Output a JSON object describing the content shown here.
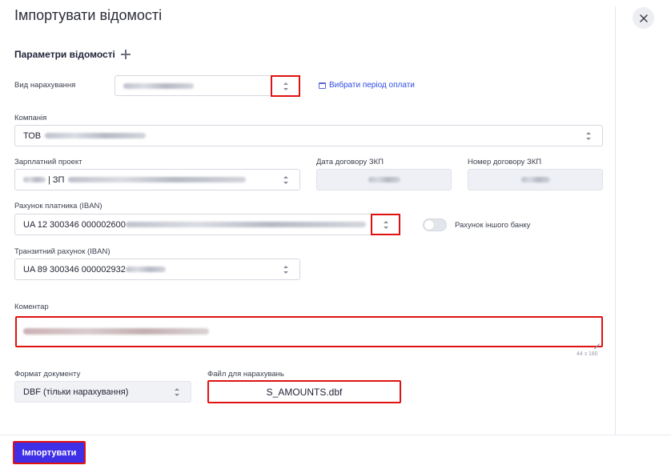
{
  "dialog": {
    "title": "Імпортувати відомості",
    "close_icon": "close-icon"
  },
  "section": {
    "title": "Параметри відомості"
  },
  "accrual_type": {
    "label": "Вид нарахування",
    "value": ""
  },
  "period_link": {
    "label": "Вибрати період оплати"
  },
  "company": {
    "label": "Компанія",
    "value_prefix": "ТОВ"
  },
  "salary_project": {
    "label": "Зарплатний проект",
    "value_prefix": "| ЗП"
  },
  "contract_date": {
    "label": "Дата договору ЗКП"
  },
  "contract_number": {
    "label": "Номер договору ЗКП"
  },
  "payer_account": {
    "label": "Рахунок платника (IBAN)",
    "value_prefix": "UA 12 300346 000002600"
  },
  "other_bank": {
    "label": "Рахунок іншого банку",
    "checked": false
  },
  "transit_account": {
    "label": "Транзитний рахунок (IBAN)",
    "value_prefix": "UA 89 300346 000002932"
  },
  "comment": {
    "label": "Коментар",
    "counter": "44 з 180"
  },
  "doc_format": {
    "label": "Формат документу",
    "value": "DBF (тільки нарахування)"
  },
  "file": {
    "label": "Файл для нарахувань",
    "value": "S_AMOUNTS.dbf"
  },
  "footer": {
    "import_label": "Імпортувати"
  },
  "colors": {
    "accent": "#3f2fe6",
    "highlight": "#e01212",
    "link": "#2f4de0"
  }
}
